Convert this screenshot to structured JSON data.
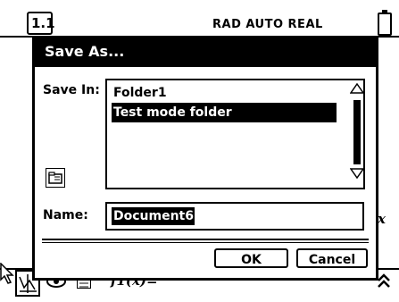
{
  "status_bar": {
    "tab_label": "1.1",
    "mode_text": "RAD AUTO REAL"
  },
  "background": {
    "entry_label": "f1(x)=",
    "x_symbol": "x"
  },
  "dialog": {
    "title": "Save As...",
    "save_in_label": "Save In:",
    "folders": [
      {
        "label": "Folder1",
        "selected": false
      },
      {
        "label": "Test mode folder",
        "selected": true
      }
    ],
    "name_label": "Name:",
    "name_value": "Document6",
    "ok_label": "OK",
    "cancel_label": "Cancel"
  },
  "icons": [
    "battery-icon",
    "graph-icon",
    "eye-icon",
    "entry-icon",
    "new-folder-icon",
    "scroll-up-icon",
    "scroll-down-icon",
    "expand-icon"
  ]
}
